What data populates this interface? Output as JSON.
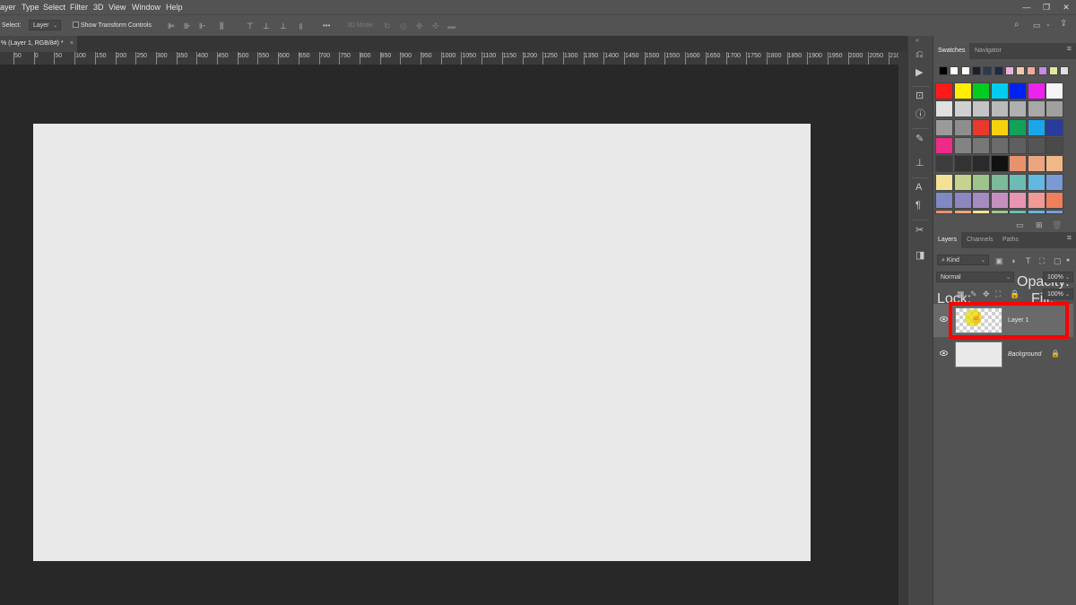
{
  "menubar": {
    "items": [
      "ayer",
      "Type",
      "Select",
      "Filter",
      "3D",
      "View",
      "Window",
      "Help"
    ],
    "window_controls": [
      "—",
      "❐",
      "✕"
    ]
  },
  "options": {
    "select_label": "Select:",
    "select_value": "Layer",
    "transform_label": "Show Transform Controls",
    "more_label": "•••",
    "mode_3d_label": "3D Mode:"
  },
  "document_tab": {
    "title": "% (Layer 1, RGB/8#) *",
    "close": "×"
  },
  "ruler": {
    "labels": [
      "50",
      "0",
      "50",
      "100",
      "150",
      "200",
      "250",
      "300",
      "350",
      "400",
      "450",
      "500",
      "550",
      "600",
      "650",
      "700",
      "750",
      "800",
      "850",
      "900",
      "950",
      "1000",
      "1050",
      "1100",
      "1150",
      "1200",
      "1250",
      "1300",
      "1350",
      "1400",
      "1450",
      "1500",
      "1550",
      "1600",
      "1650",
      "1700",
      "1750",
      "1800",
      "1850",
      "1900",
      "1950",
      "2000",
      "2050",
      "2100"
    ]
  },
  "swatches_panel": {
    "tabs": [
      "Swatches",
      "Navigator"
    ],
    "recent": [
      "#000000",
      "#ffffff",
      "#ffffff",
      "#1a1f2b",
      "#2b3a4f",
      "#1f2a44",
      "#e9b3e0",
      "#f0c8b0",
      "#f3a7a0",
      "#c78be0",
      "#e6e6a0",
      "#e0e0e0"
    ],
    "rows": [
      [
        "#ff1a1a",
        "#ffee00",
        "#00cc22",
        "#00ccee",
        "#0022ee",
        "#ee22ee",
        "#f5f5f5"
      ],
      [
        "#e0e0e0",
        "#d0d0d0",
        "#c4c4c4",
        "#bababa",
        "#b0b0b0",
        "#a8a8a8",
        "#a0a0a0"
      ],
      [
        "#9a9a9a",
        "#8e8e8e",
        "#e8392c",
        "#f5d20c",
        "#12a158",
        "#1aa6e8",
        "#283c9e"
      ],
      [
        "#ed2c87",
        "#838383",
        "#777777",
        "#6b6b6b",
        "#5f5f5f",
        "#555555",
        "#4a4a4a"
      ],
      [
        "#3d3d3d",
        "#333333",
        "#2a2a2a",
        "#111111",
        "#e8926c",
        "#eba580",
        "#f0b888"
      ],
      [
        "#f2e298",
        "#c5d38f",
        "#9ec48c",
        "#7cba9a",
        "#6cbcb5",
        "#62b8e0",
        "#7a9ad6"
      ],
      [
        "#7f8ac4",
        "#8d86c0",
        "#a48bc0",
        "#c590c0",
        "#e994b0",
        "#ef9a96",
        "#ef7f5c"
      ],
      [
        "#e8926c",
        "#eba580",
        "#f2e298",
        "#9ec48c",
        "#6cbcb5",
        "#62b8e0",
        "#7a9ad6"
      ]
    ]
  },
  "layers_panel": {
    "tabs": [
      "Layers",
      "Channels",
      "Paths"
    ],
    "filter_value": "Kind",
    "blend_mode": "Normal",
    "opacity_label": "Opacity:",
    "opacity_value": "100%",
    "lock_label": "Lock:",
    "fill_label": "Fill:",
    "fill_value": "100%",
    "layers": [
      {
        "name": "Layer 1",
        "selected": true
      },
      {
        "name": "Background",
        "locked": true
      }
    ]
  },
  "colors": {
    "highlight": "#ff0000",
    "canvas": "#e9e9e9"
  }
}
